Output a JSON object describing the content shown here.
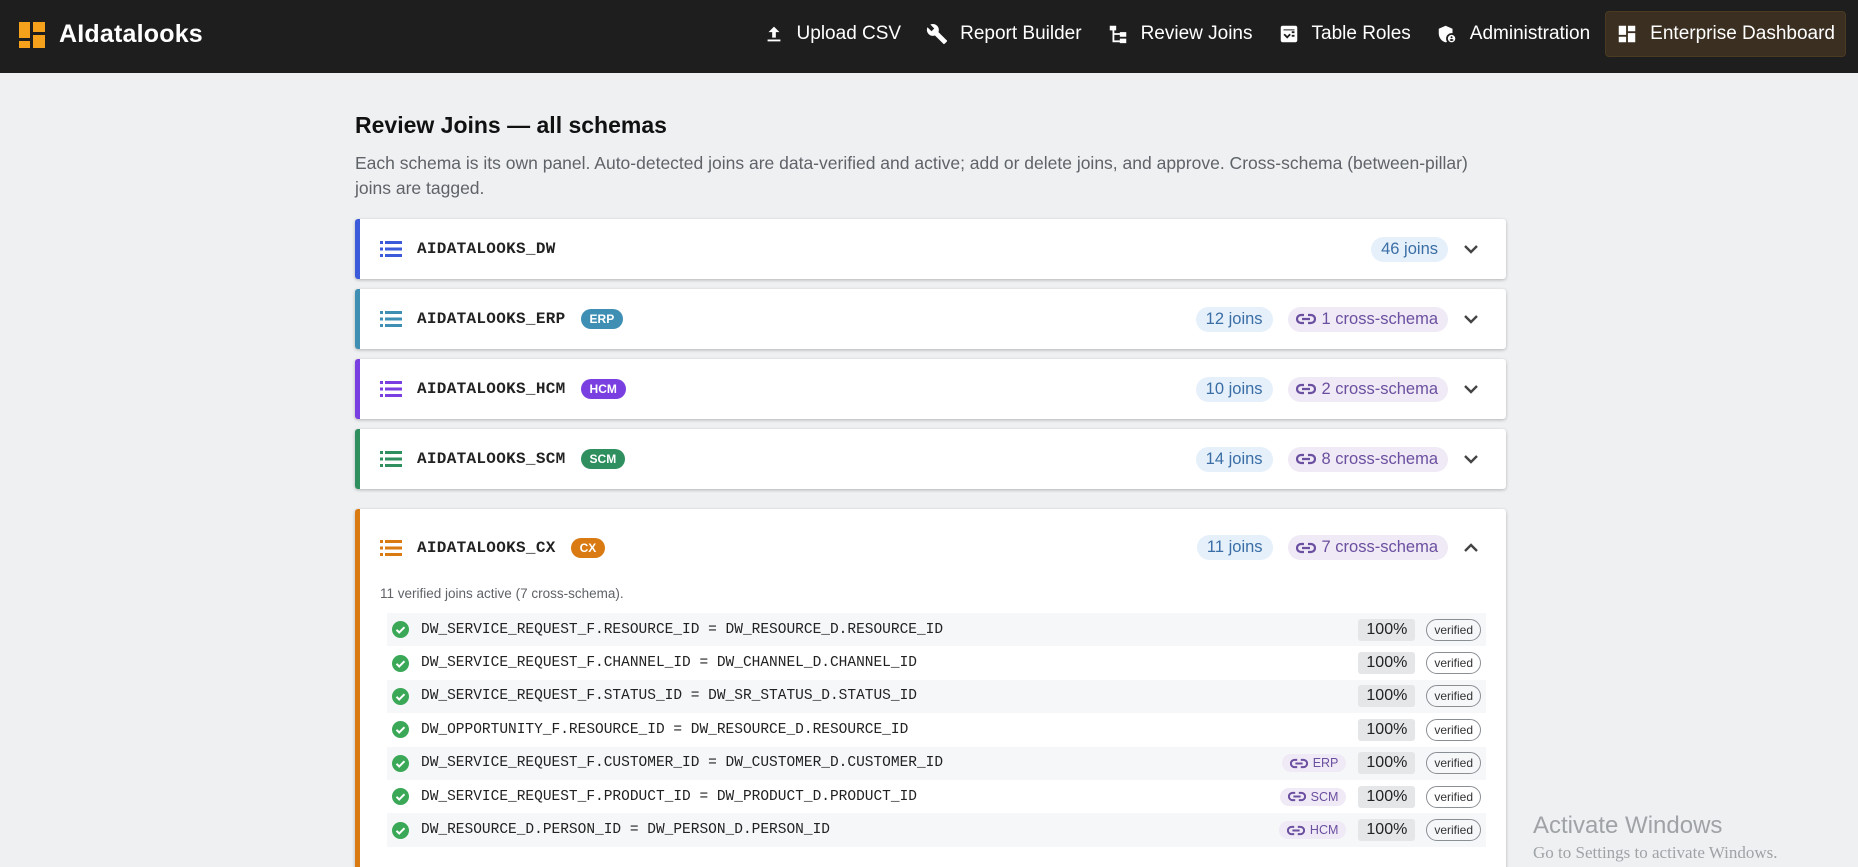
{
  "brand": {
    "name": "AIdatalooks"
  },
  "nav": [
    {
      "label": "Upload CSV",
      "icon": "upload-icon"
    },
    {
      "label": "Report Builder",
      "icon": "wrench-icon"
    },
    {
      "label": "Review Joins",
      "icon": "joins-icon"
    },
    {
      "label": "Table Roles",
      "icon": "checklist-icon"
    },
    {
      "label": "Administration",
      "icon": "admin-icon"
    },
    {
      "label": "Enterprise Dashboard",
      "icon": "dashboard-icon",
      "active": true
    }
  ],
  "page": {
    "title": "Review Joins — all schemas",
    "description": "Each schema is its own panel. Auto-detected joins are data-verified and active; add or delete joins, and approve. Cross-schema (between-pillar) joins are tagged."
  },
  "panels": [
    {
      "name": "AIDATALOOKS_DW",
      "tag": "",
      "joins": "46 joins",
      "cross": "",
      "color": "#3b5bdb",
      "expanded": false
    },
    {
      "name": "AIDATALOOKS_ERP",
      "tag": "ERP",
      "joins": "12 joins",
      "cross": "1 cross-schema",
      "color": "#3f8fb5",
      "expanded": false
    },
    {
      "name": "AIDATALOOKS_HCM",
      "tag": "HCM",
      "joins": "10 joins",
      "cross": "2 cross-schema",
      "color": "#7a3fe0",
      "expanded": false
    },
    {
      "name": "AIDATALOOKS_SCM",
      "tag": "SCM",
      "joins": "14 joins",
      "cross": "8 cross-schema",
      "color": "#2f8f5f",
      "expanded": false
    },
    {
      "name": "AIDATALOOKS_CX",
      "tag": "CX",
      "joins": "11 joins",
      "cross": "7 cross-schema",
      "color": "#d97a12",
      "expanded": true
    }
  ],
  "cx": {
    "summary": "11 verified joins active (7 cross-schema).",
    "rows": [
      {
        "expr": "DW_SERVICE_REQUEST_F.RESOURCE_ID = DW_RESOURCE_D.RESOURCE_ID",
        "xtag": "",
        "pct": "100%",
        "status": "verified"
      },
      {
        "expr": "DW_SERVICE_REQUEST_F.CHANNEL_ID = DW_CHANNEL_D.CHANNEL_ID",
        "xtag": "",
        "pct": "100%",
        "status": "verified"
      },
      {
        "expr": "DW_SERVICE_REQUEST_F.STATUS_ID = DW_SR_STATUS_D.STATUS_ID",
        "xtag": "",
        "pct": "100%",
        "status": "verified"
      },
      {
        "expr": "DW_OPPORTUNITY_F.RESOURCE_ID = DW_RESOURCE_D.RESOURCE_ID",
        "xtag": "",
        "pct": "100%",
        "status": "verified"
      },
      {
        "expr": "DW_SERVICE_REQUEST_F.CUSTOMER_ID = DW_CUSTOMER_D.CUSTOMER_ID",
        "xtag": "ERP",
        "pct": "100%",
        "status": "verified"
      },
      {
        "expr": "DW_SERVICE_REQUEST_F.PRODUCT_ID = DW_PRODUCT_D.PRODUCT_ID",
        "xtag": "SCM",
        "pct": "100%",
        "status": "verified"
      },
      {
        "expr": "DW_RESOURCE_D.PERSON_ID = DW_PERSON_D.PERSON_ID",
        "xtag": "HCM",
        "pct": "100%",
        "status": "verified"
      }
    ]
  },
  "watermark": {
    "line1": "Activate Windows",
    "line2": "Go to Settings to activate Windows."
  }
}
